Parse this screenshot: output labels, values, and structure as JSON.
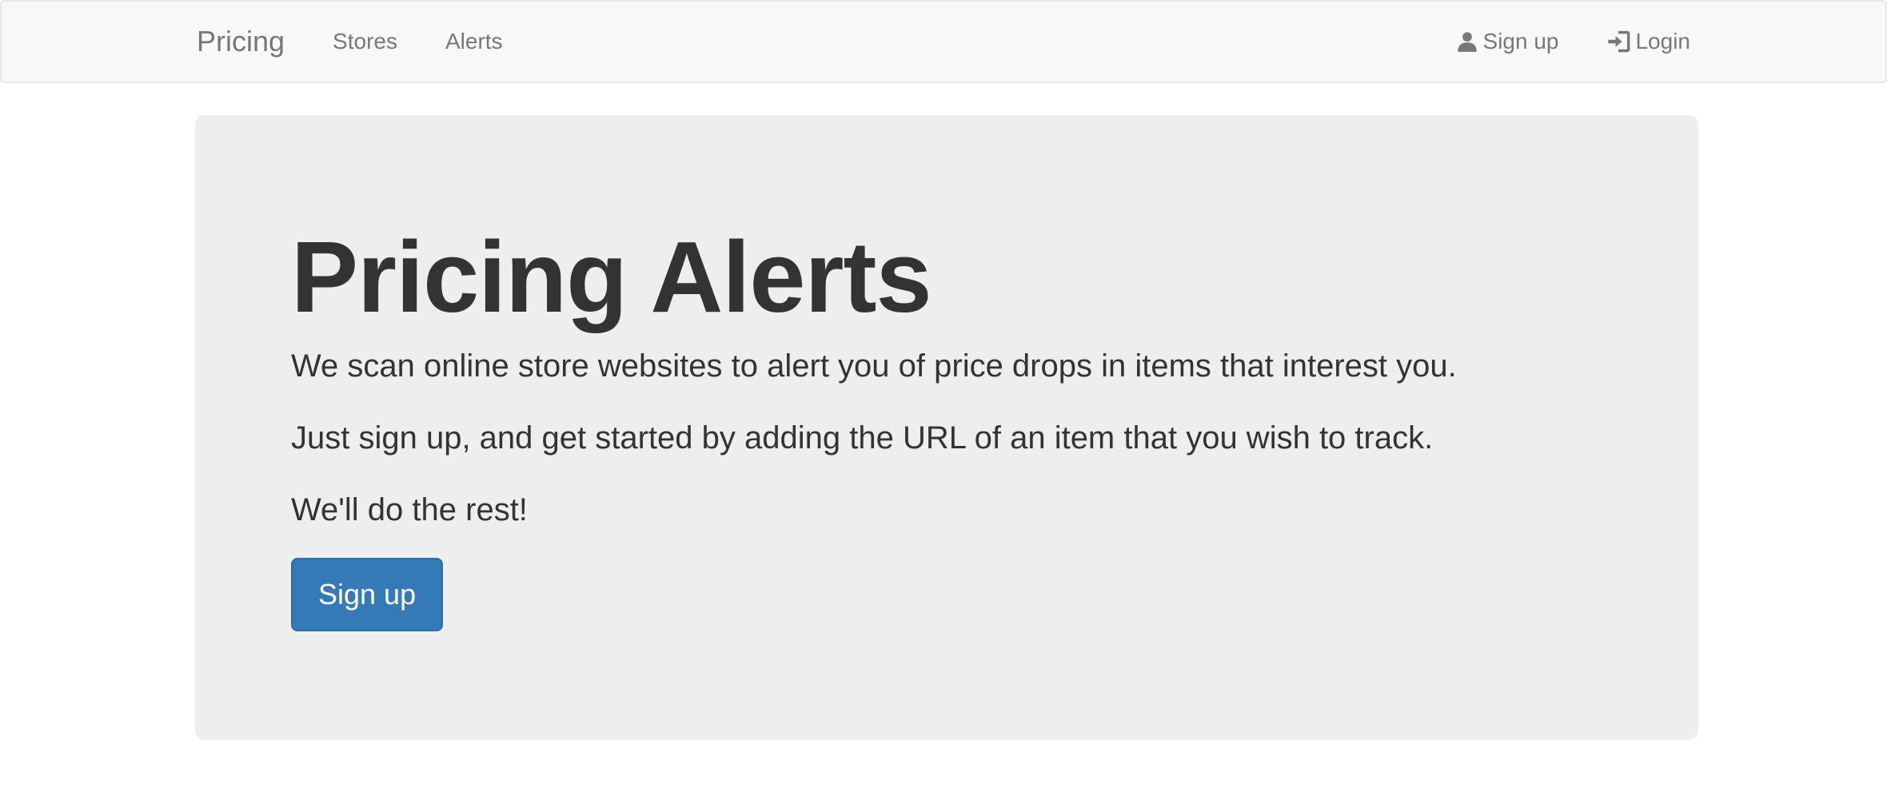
{
  "navbar": {
    "brand": "Pricing",
    "links": [
      {
        "label": "Stores"
      },
      {
        "label": "Alerts"
      }
    ],
    "right_links": [
      {
        "label": "Sign up",
        "icon": "user-icon"
      },
      {
        "label": "Login",
        "icon": "login-icon"
      }
    ]
  },
  "hero": {
    "title": "Pricing Alerts",
    "paragraphs": [
      "We scan online store websites to alert you of price drops in items that interest you.",
      "Just sign up, and get started by adding the URL of an item that you wish to track.",
      "We'll do the rest!"
    ],
    "button_label": "Sign up"
  },
  "colors": {
    "primary": "#337ab7",
    "navbar_bg": "#f8f8f8",
    "jumbotron_bg": "#eeeeee",
    "text": "#333333",
    "nav_text": "#777777"
  }
}
